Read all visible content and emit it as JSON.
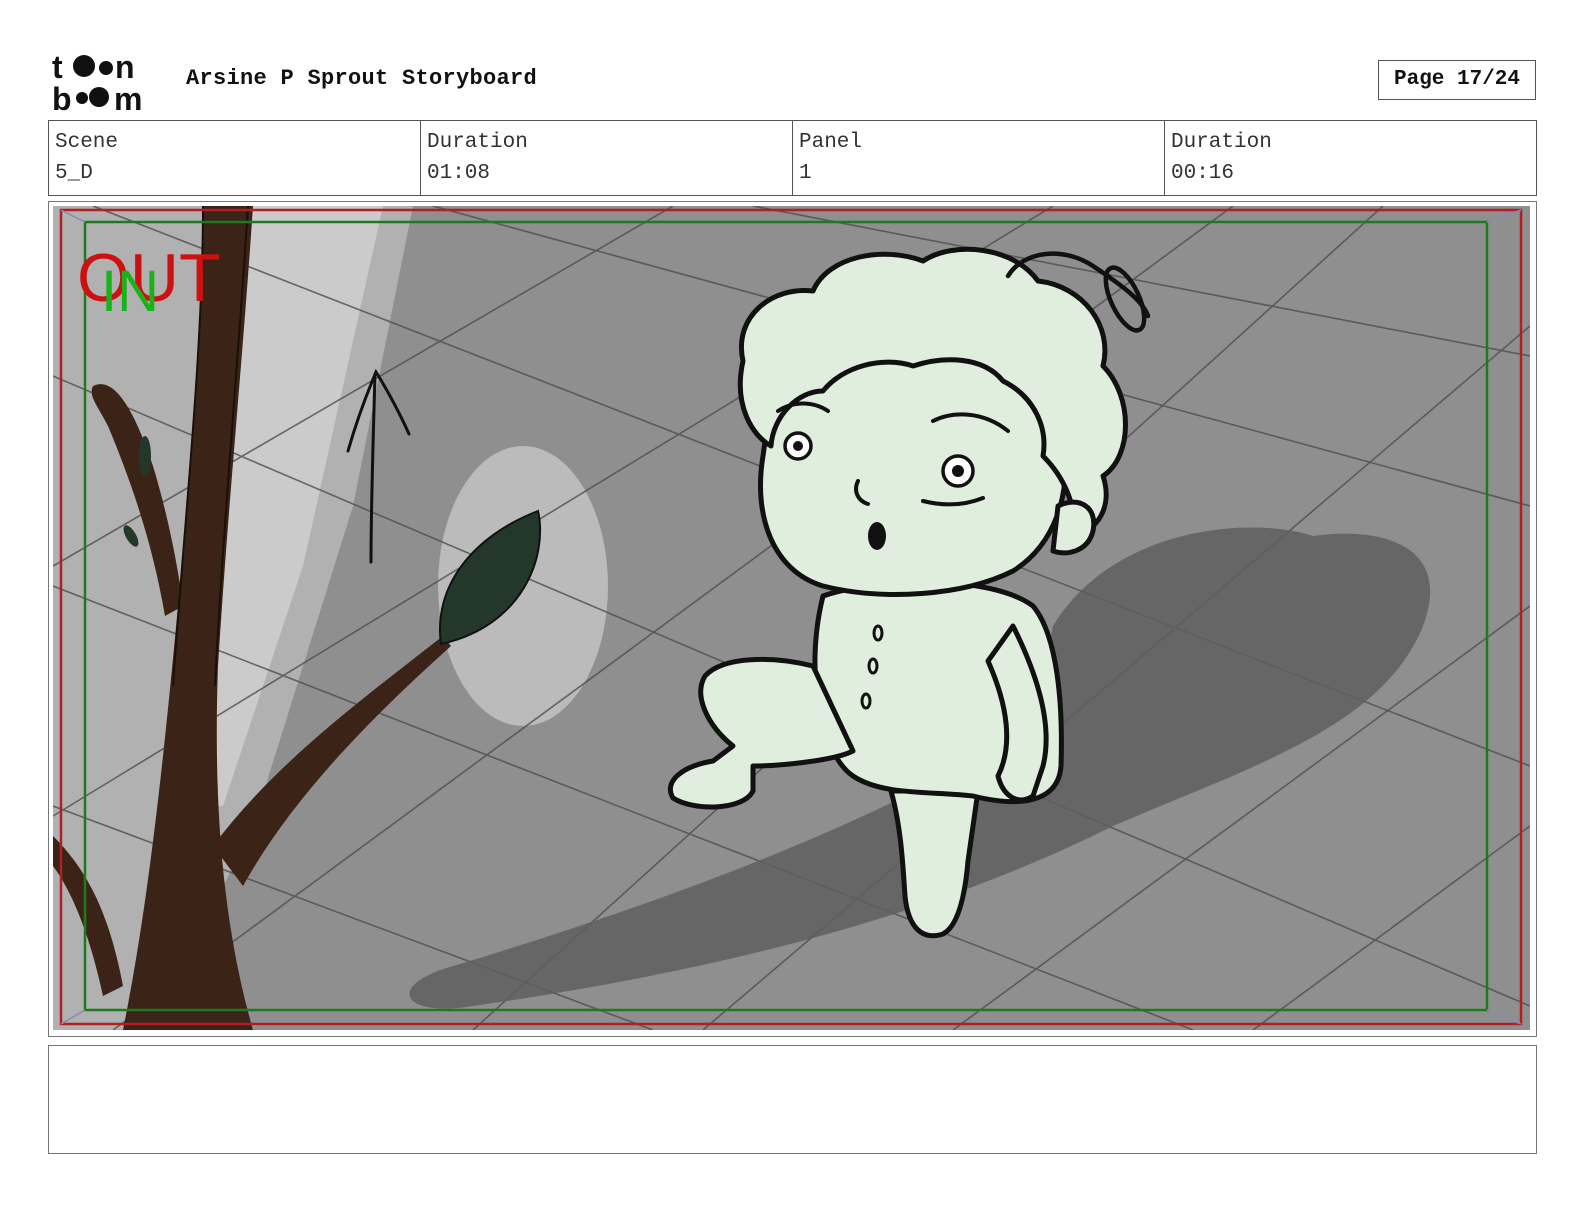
{
  "header": {
    "logo_alt": "toon boom",
    "title": "Arsine P Sprout Storyboard",
    "page_label": "Page 17/24"
  },
  "info": [
    {
      "label": "Scene",
      "value": "5_D"
    },
    {
      "label": "Duration",
      "value": "01:08"
    },
    {
      "label": "Panel",
      "value": "1"
    },
    {
      "label": "Duration",
      "value": "00:16"
    }
  ],
  "panel": {
    "out_label": "OUT",
    "in_label": "IN",
    "out_color": "#cc1111",
    "in_color": "#19b219",
    "safe_frame_color": "#b01f24",
    "title_safe_color": "#1f7a1f"
  },
  "notes": {
    "text": ""
  }
}
